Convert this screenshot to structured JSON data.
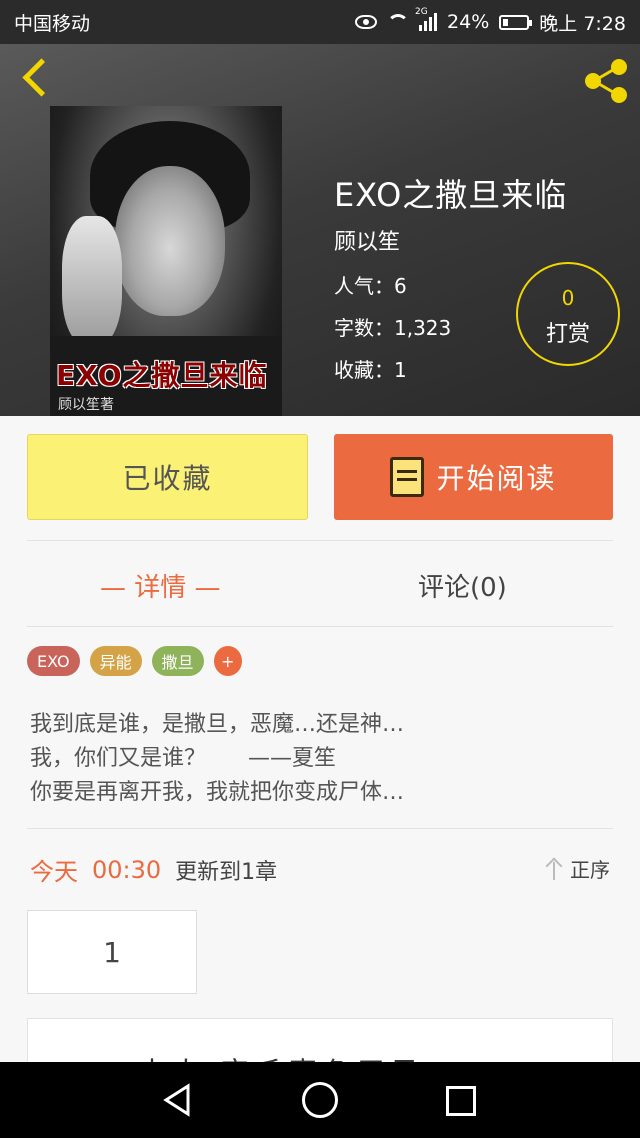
{
  "status_bar": {
    "carrier": "中国移动",
    "network": "2G",
    "battery": "24%",
    "battery_level": 0.24,
    "time": "晚上 7:28"
  },
  "header": {
    "back_icon": "chevron-left-icon",
    "share_icon": "share-icon",
    "accent_color": "#f2d600"
  },
  "cover": {
    "title": "EXO之撒旦来临",
    "author": "顾以笙著"
  },
  "book": {
    "title": "EXO之撒旦来临",
    "author": "顾以笙",
    "popularity": "人气：6",
    "word_count": "字数：1,323",
    "favorites": "收藏：1"
  },
  "reward": {
    "count": "0",
    "label": "打赏"
  },
  "actions": {
    "favorited_label": "已收藏",
    "read_label": "开始阅读",
    "read_color": "#eb6a3f",
    "favorited_color": "#fbf174"
  },
  "tabs": [
    {
      "label": "— 详情 —",
      "active": true
    },
    {
      "label": "评论(0)",
      "active": false
    }
  ],
  "tags": [
    {
      "label": "EXO",
      "color": "#c9645a"
    },
    {
      "label": "异能",
      "color": "#d4a348"
    },
    {
      "label": "撒旦",
      "color": "#8fb35a"
    },
    {
      "label": "+",
      "color": "#eb6a3f"
    }
  ],
  "description": [
    "我到底是谁，是撒旦，恶魔…还是神…",
    "我，你们又是谁？      ——夏笙",
    "你要是再离开我，我就把你变成尸体…"
  ],
  "update": {
    "day": "今天",
    "time": "00:30",
    "info": "更新到1章",
    "order_label": "正序"
  },
  "chapters": [
    "1"
  ],
  "recommend_preview": "大人  恋毛声色习录"
}
